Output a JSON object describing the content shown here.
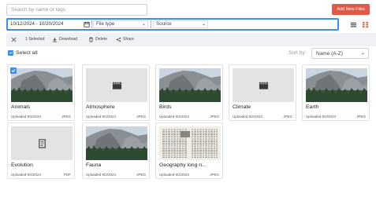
{
  "search": {
    "placeholder": "Search by name or tags"
  },
  "toolbar": {
    "add_button": "Add New Files"
  },
  "filters": {
    "date_range": "10/12/2024 - 10/20/2024",
    "file_type": "File type",
    "source": "Source"
  },
  "actions": {
    "selected": "1 Selected",
    "download": "Download",
    "delete": "Delete",
    "share": "Share"
  },
  "list": {
    "select_all": "Select all",
    "sort_label": "Sort by:",
    "sort_value": "Name (A-Z)"
  },
  "colors": {
    "accent": "#3f8fe8",
    "add_button": "#e05a47"
  },
  "files": [
    {
      "name": "Animals",
      "meta": "Uploaded 9/2/2024",
      "type": "JPEG",
      "thumb": "landscape",
      "selected": true
    },
    {
      "name": "Atmosphere",
      "meta": "Uploaded 9/2/2024",
      "type": "JPEG",
      "thumb": "video-icon",
      "selected": false
    },
    {
      "name": "Birds",
      "meta": "Uploaded 9/2/2024",
      "type": "JPEG",
      "thumb": "landscape",
      "selected": false
    },
    {
      "name": "Climate",
      "meta": "Uploaded 9/2/2024",
      "type": "JPEG",
      "thumb": "video-icon",
      "selected": false
    },
    {
      "name": "Earth",
      "meta": "Uploaded 9/2/2024",
      "type": "JPEG",
      "thumb": "landscape",
      "selected": false
    },
    {
      "name": "Evolution",
      "meta": "Uploaded 9/2/2024",
      "type": "PDF",
      "thumb": "document-icon",
      "selected": false
    },
    {
      "name": "Fauna",
      "meta": "Uploaded 9/2/2024",
      "type": "JPEG",
      "thumb": "landscape",
      "selected": false
    },
    {
      "name": "Geography long n...",
      "meta": "Uploaded 9/2/2024",
      "type": "JPEG",
      "thumb": "document-scan",
      "selected": false
    }
  ]
}
